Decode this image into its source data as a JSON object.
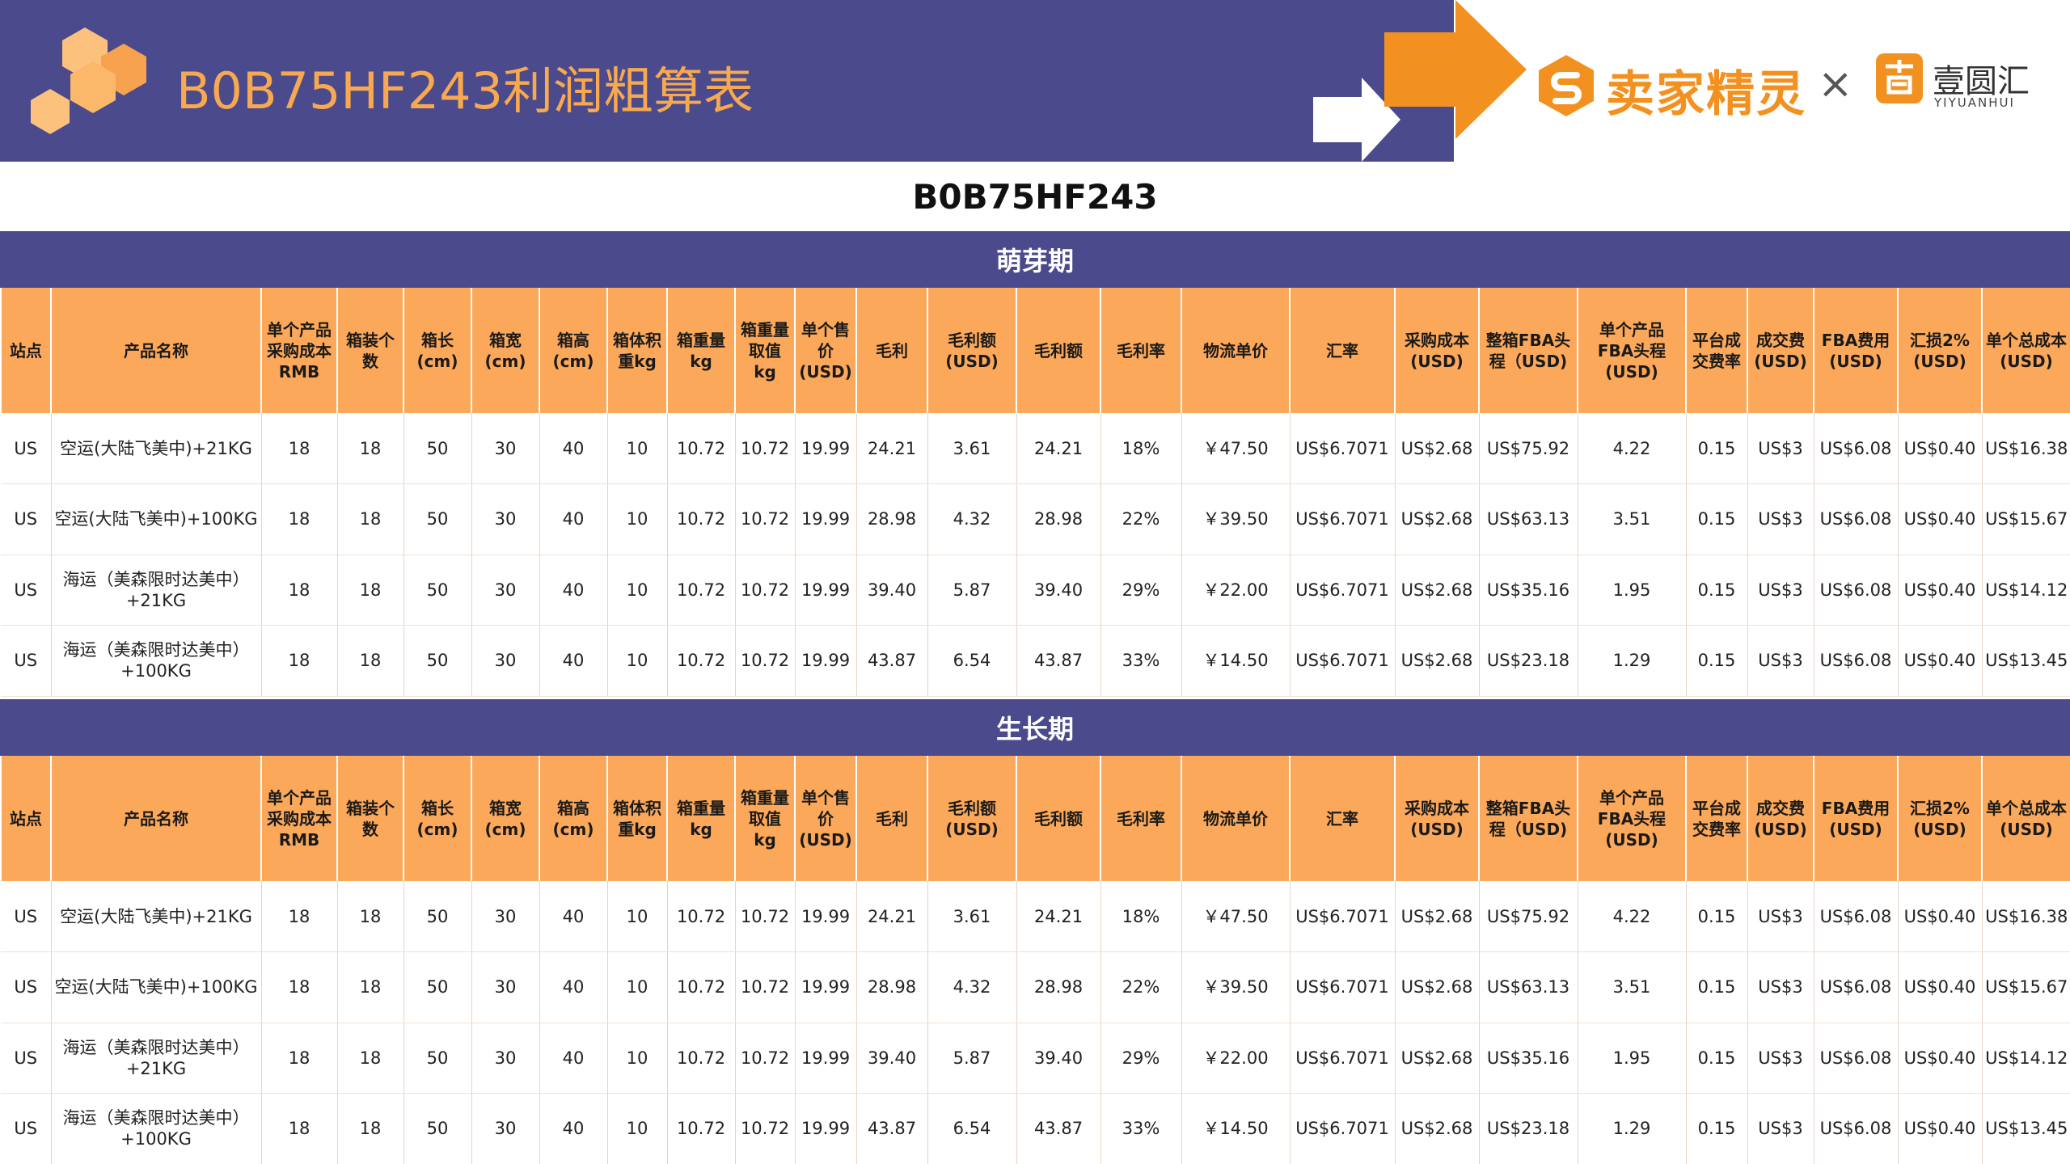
{
  "header": {
    "title": "B0B75HF243利润粗算表",
    "brand_primary": "卖家精灵",
    "separator": "×",
    "brand_secondary": "壹圆汇",
    "brand_secondary_sub": "YIYUANHUI"
  },
  "colors": {
    "banner": "#4a4a8c",
    "accent_orange": "#f39120",
    "header_cell": "#fca85a",
    "hex_light": "#fbc17d"
  },
  "page_title": "B0B75HF243",
  "columns": [
    "站点",
    "产品名称",
    "单个产品\n采购成本\nRMB",
    "箱装个\n数",
    "箱长\n(cm)",
    "箱宽\n(cm)",
    "箱高\n(cm)",
    "箱体积\n重kg",
    "箱重量\nkg",
    "箱重量\n取值\nkg",
    "单个售\n价\n(USD)",
    "毛利",
    "毛利额\n(USD)",
    "毛利额",
    "毛利率",
    "物流单价",
    "汇率",
    "采购成本\n(USD)",
    "整箱FBA头\n程（USD)",
    "单个产品\nFBA头程\n(USD)",
    "平台成\n交费率",
    "成交费\n(USD)",
    "FBA费用\n(USD)",
    "汇损2%\n(USD)",
    "单个总成本\n(USD)"
  ],
  "sections": [
    {
      "title": "萌芽期",
      "rows": [
        [
          "US",
          "空运(大陆飞美中)+21KG",
          "18",
          "18",
          "50",
          "30",
          "40",
          "10",
          "10.72",
          "10.72",
          "19.99",
          "24.21",
          "3.61",
          "24.21",
          "18%",
          "￥47.50",
          "US$6.7071",
          "US$2.68",
          "US$75.92",
          "4.22",
          "0.15",
          "US$3",
          "US$6.08",
          "US$0.40",
          "US$16.38"
        ],
        [
          "US",
          "空运(大陆飞美中)+100KG",
          "18",
          "18",
          "50",
          "30",
          "40",
          "10",
          "10.72",
          "10.72",
          "19.99",
          "28.98",
          "4.32",
          "28.98",
          "22%",
          "￥39.50",
          "US$6.7071",
          "US$2.68",
          "US$63.13",
          "3.51",
          "0.15",
          "US$3",
          "US$6.08",
          "US$0.40",
          "US$15.67"
        ],
        [
          "US",
          "海运（美森限时达美中）+21KG",
          "18",
          "18",
          "50",
          "30",
          "40",
          "10",
          "10.72",
          "10.72",
          "19.99",
          "39.40",
          "5.87",
          "39.40",
          "29%",
          "￥22.00",
          "US$6.7071",
          "US$2.68",
          "US$35.16",
          "1.95",
          "0.15",
          "US$3",
          "US$6.08",
          "US$0.40",
          "US$14.12"
        ],
        [
          "US",
          "海运（美森限时达美中）+100KG",
          "18",
          "18",
          "50",
          "30",
          "40",
          "10",
          "10.72",
          "10.72",
          "19.99",
          "43.87",
          "6.54",
          "43.87",
          "33%",
          "￥14.50",
          "US$6.7071",
          "US$2.68",
          "US$23.18",
          "1.29",
          "0.15",
          "US$3",
          "US$6.08",
          "US$0.40",
          "US$13.45"
        ]
      ]
    },
    {
      "title": "生长期",
      "rows": [
        [
          "US",
          "空运(大陆飞美中)+21KG",
          "18",
          "18",
          "50",
          "30",
          "40",
          "10",
          "10.72",
          "10.72",
          "19.99",
          "24.21",
          "3.61",
          "24.21",
          "18%",
          "￥47.50",
          "US$6.7071",
          "US$2.68",
          "US$75.92",
          "4.22",
          "0.15",
          "US$3",
          "US$6.08",
          "US$0.40",
          "US$16.38"
        ],
        [
          "US",
          "空运(大陆飞美中)+100KG",
          "18",
          "18",
          "50",
          "30",
          "40",
          "10",
          "10.72",
          "10.72",
          "19.99",
          "28.98",
          "4.32",
          "28.98",
          "22%",
          "￥39.50",
          "US$6.7071",
          "US$2.68",
          "US$63.13",
          "3.51",
          "0.15",
          "US$3",
          "US$6.08",
          "US$0.40",
          "US$15.67"
        ],
        [
          "US",
          "海运（美森限时达美中）+21KG",
          "18",
          "18",
          "50",
          "30",
          "40",
          "10",
          "10.72",
          "10.72",
          "19.99",
          "39.40",
          "5.87",
          "39.40",
          "29%",
          "￥22.00",
          "US$6.7071",
          "US$2.68",
          "US$35.16",
          "1.95",
          "0.15",
          "US$3",
          "US$6.08",
          "US$0.40",
          "US$14.12"
        ],
        [
          "US",
          "海运（美森限时达美中）+100KG",
          "18",
          "18",
          "50",
          "30",
          "40",
          "10",
          "10.72",
          "10.72",
          "19.99",
          "43.87",
          "6.54",
          "43.87",
          "33%",
          "￥14.50",
          "US$6.7071",
          "US$2.68",
          "US$23.18",
          "1.29",
          "0.15",
          "US$3",
          "US$6.08",
          "US$0.40",
          "US$13.45"
        ]
      ]
    }
  ]
}
